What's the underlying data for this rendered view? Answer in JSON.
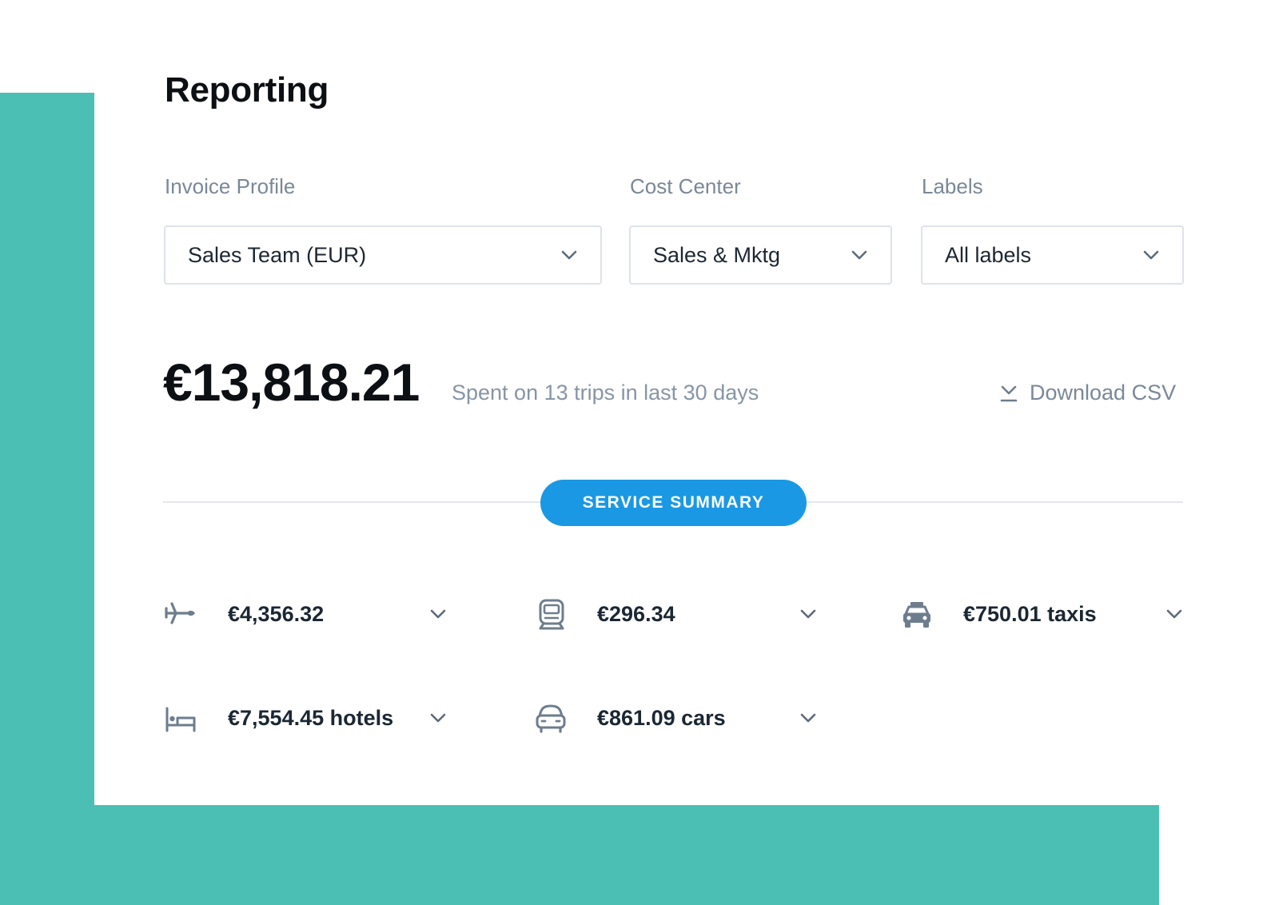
{
  "page": {
    "title": "Reporting"
  },
  "filters": {
    "invoice_profile": {
      "label": "Invoice Profile",
      "value": "Sales Team (EUR)"
    },
    "cost_center": {
      "label": "Cost Center",
      "value": "Sales & Mktg"
    },
    "labels": {
      "label": "Labels",
      "value": "All labels"
    }
  },
  "summary": {
    "total": "€13,818.21",
    "subtitle": "Spent on 13 trips in last 30 days",
    "download_label": "Download CSV"
  },
  "section_button": "SERVICE SUMMARY",
  "services": [
    {
      "icon": "airplane-icon",
      "amount": "€4,356.32"
    },
    {
      "icon": "train-icon",
      "amount": "€296.34"
    },
    {
      "icon": "taxi-icon",
      "amount": "€750.01 taxis"
    },
    {
      "icon": "bed-icon",
      "amount": "€7,554.45 hotels"
    },
    {
      "icon": "car-icon",
      "amount": "€861.09 cars"
    }
  ],
  "colors": {
    "accent_teal": "#4bbfb3",
    "primary_blue": "#1a98e4",
    "muted_text": "#7a8898"
  }
}
